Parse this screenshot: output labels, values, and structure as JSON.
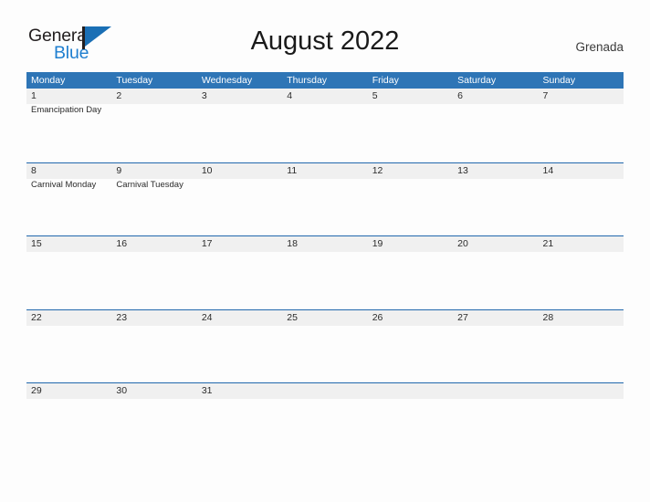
{
  "logo": {
    "word_top": "General",
    "word_bottom": "Blue",
    "flag_icon": "flag-triangle-icon",
    "colors": {
      "dark": "#231f20",
      "blue": "#1f7fd0",
      "flag": "#1a6fb5"
    }
  },
  "header": {
    "title": "August 2022",
    "country": "Grenada"
  },
  "theme": {
    "header_blue": "#2e75b6",
    "row_rule_blue": "#2168ad",
    "band_gray": "#f0f0f0",
    "page_background": "#fdfdfd",
    "text": "#2b2b2b"
  },
  "calendar": {
    "weekdays": [
      "Monday",
      "Tuesday",
      "Wednesday",
      "Thursday",
      "Friday",
      "Saturday",
      "Sunday"
    ],
    "weeks": [
      [
        {
          "day": "1",
          "event": "Emancipation Day"
        },
        {
          "day": "2",
          "event": ""
        },
        {
          "day": "3",
          "event": ""
        },
        {
          "day": "4",
          "event": ""
        },
        {
          "day": "5",
          "event": ""
        },
        {
          "day": "6",
          "event": ""
        },
        {
          "day": "7",
          "event": ""
        }
      ],
      [
        {
          "day": "8",
          "event": "Carnival Monday"
        },
        {
          "day": "9",
          "event": "Carnival Tuesday"
        },
        {
          "day": "10",
          "event": ""
        },
        {
          "day": "11",
          "event": ""
        },
        {
          "day": "12",
          "event": ""
        },
        {
          "day": "13",
          "event": ""
        },
        {
          "day": "14",
          "event": ""
        }
      ],
      [
        {
          "day": "15",
          "event": ""
        },
        {
          "day": "16",
          "event": ""
        },
        {
          "day": "17",
          "event": ""
        },
        {
          "day": "18",
          "event": ""
        },
        {
          "day": "19",
          "event": ""
        },
        {
          "day": "20",
          "event": ""
        },
        {
          "day": "21",
          "event": ""
        }
      ],
      [
        {
          "day": "22",
          "event": ""
        },
        {
          "day": "23",
          "event": ""
        },
        {
          "day": "24",
          "event": ""
        },
        {
          "day": "25",
          "event": ""
        },
        {
          "day": "26",
          "event": ""
        },
        {
          "day": "27",
          "event": ""
        },
        {
          "day": "28",
          "event": ""
        }
      ],
      [
        {
          "day": "29",
          "event": ""
        },
        {
          "day": "30",
          "event": ""
        },
        {
          "day": "31",
          "event": ""
        },
        {
          "day": "",
          "event": ""
        },
        {
          "day": "",
          "event": ""
        },
        {
          "day": "",
          "event": ""
        },
        {
          "day": "",
          "event": ""
        }
      ]
    ]
  }
}
